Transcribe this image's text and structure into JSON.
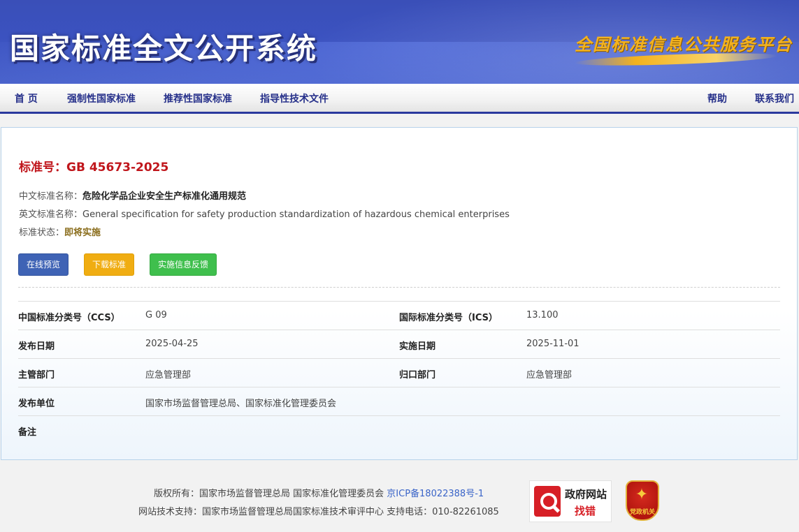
{
  "header": {
    "site_title": "国家标准全文公开系统",
    "slogan": "全国标准信息公共服务平台"
  },
  "nav": {
    "home": "首 页",
    "mandatory": "强制性国家标准",
    "recommended": "推荐性国家标准",
    "guidance": "指导性技术文件",
    "help": "帮助",
    "contact": "联系我们"
  },
  "standard": {
    "number_label": "标准号：GB 45673-2025",
    "cn_name_key": "中文标准名称：",
    "cn_name": "危险化学品企业安全生产标准化通用规范",
    "en_name_key": "英文标准名称：",
    "en_name": "General specification for safety production standardization of hazardous chemical enterprises",
    "status_key": "标准状态：",
    "status": "即将实施"
  },
  "actions": {
    "preview": "在线预览",
    "download": "下载标准",
    "feedback": "实施信息反馈"
  },
  "details": {
    "ccs_key": "中国标准分类号（CCS）",
    "ccs_val": "G 09",
    "ics_key": "国际标准分类号（ICS）",
    "ics_val": "13.100",
    "pub_date_key": "发布日期",
    "pub_date_val": "2025-04-25",
    "impl_date_key": "实施日期",
    "impl_date_val": "2025-11-01",
    "dept_key": "主管部门",
    "dept_val": "应急管理部",
    "owner_key": "归口部门",
    "owner_val": "应急管理部",
    "publisher_key": "发布单位",
    "publisher_val": "国家市场监督管理总局、国家标准化管理委员会",
    "remark_key": "备注"
  },
  "footer": {
    "copyright": "版权所有：国家市场监督管理总局 国家标准化管理委员会",
    "icp": "京ICP备18022388号-1",
    "support": "网站技术支持：国家市场监督管理总局国家标准技术审评中心 支持电话：010-82261085",
    "gov_badge_line1": "政府网站",
    "gov_badge_line2": "找错",
    "party_badge": "党政机关"
  }
}
